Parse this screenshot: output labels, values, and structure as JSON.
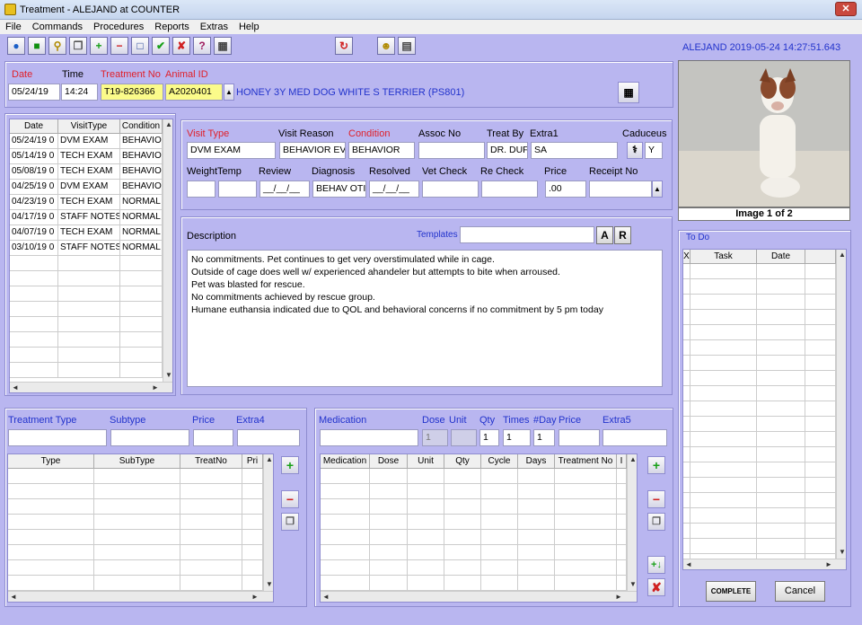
{
  "window": {
    "title": "Treatment  -  ALEJAND at COUNTER"
  },
  "menu": [
    "File",
    "Commands",
    "Procedures",
    "Reports",
    "Extras",
    "Help"
  ],
  "status": "ALEJAND 2019-05-24 14:27:51.643",
  "header": {
    "date_label": "Date",
    "time_label": "Time",
    "treatno_label": "Treatment No",
    "animal_label": "Animal ID",
    "date": "05/24/19",
    "time": "14:24",
    "treatno": "T19-826366",
    "animal": "A2020401",
    "animal_desc": "HONEY 3Y MED DOG WHITE S TERRIER (PS801)"
  },
  "photo": {
    "caption": "Image 1 of 2"
  },
  "history": {
    "columns": [
      "Date",
      "VisitType",
      "Condition"
    ],
    "rows": [
      [
        "05/24/19 0",
        "DVM EXAM",
        "BEHAVIOI"
      ],
      [
        "05/14/19 0",
        "TECH EXAM",
        "BEHAVIOI"
      ],
      [
        "05/08/19 0",
        "TECH EXAM",
        "BEHAVIOI"
      ],
      [
        "04/25/19 0",
        "DVM EXAM",
        "BEHAVIOI"
      ],
      [
        "04/23/19 0",
        "TECH EXAM",
        "NORMAL"
      ],
      [
        "04/17/19 0",
        "STAFF NOTES",
        "NORMAL"
      ],
      [
        "04/07/19 0",
        "TECH EXAM",
        "NORMAL"
      ],
      [
        "03/10/19 0",
        "STAFF NOTES",
        "NORMAL"
      ]
    ]
  },
  "visit": {
    "visit_type_label": "Visit Type",
    "visit_reason_label": "Visit Reason",
    "condition_label": "Condition",
    "assoc_label": "Assoc No",
    "treatby_label": "Treat By",
    "extra1_label": "Extra1",
    "caduceus_label": "Caduceus",
    "visit_type": "DVM EXAM",
    "visit_reason": "BEHAVIOR EV",
    "condition": "BEHAVIOR",
    "assoc": "",
    "treatby": "DR. DUF",
    "extra1": "SA",
    "caduceus": "Y",
    "weight_label": "Weight",
    "temp_label": "Temp",
    "review_label": "Review",
    "diagnosis_label": "Diagnosis",
    "resolved_label": "Resolved",
    "vetcheck_label": "Vet Check",
    "recheck_label": "Re Check",
    "price_label": "Price",
    "receipt_label": "Receipt No",
    "weight": "",
    "temp": "",
    "review": "__/__/__",
    "diagnosis": "BEHAV OTI",
    "resolved": "__/__/__",
    "vetcheck": "",
    "recheck": "",
    "price": ".00",
    "receipt": ""
  },
  "description": {
    "label": "Description",
    "templates_label": "Templates",
    "btn_a": "A",
    "btn_r": "R",
    "text": "No commitments. Pet continues to get very overstimulated while in cage.\nOutside of cage does well w/ experienced ahandeler but attempts to bite when arroused.\nPet was blasted for rescue.\nNo commitments achieved by rescue group.\nHumane euthansia indicated due to QOL and behavioral concerns if no commitment by 5 pm today"
  },
  "todo": {
    "label": "To Do",
    "columns": [
      "X",
      "Task",
      "Date"
    ]
  },
  "treatment": {
    "type_label": "Treatment Type",
    "subtype_label": "Subtype",
    "price_label": "Price",
    "extra4_label": "Extra4",
    "columns": [
      "Type",
      "SubType",
      "TreatNo",
      "Pri"
    ]
  },
  "medication": {
    "med_label": "Medication",
    "dose_label": "Dose",
    "unit_label": "Unit",
    "qty_label": "Qty",
    "times_label": "Times",
    "days_label": "#Day",
    "price_label": "Price",
    "extra5_label": "Extra5",
    "dose": "1",
    "qty": "1",
    "times": "1",
    "days": "1",
    "columns": [
      "Medication",
      "Dose",
      "Unit",
      "Qty",
      "Cycle",
      "Days",
      "Treatment No",
      "I"
    ]
  },
  "buttons": {
    "complete": "COMPLETE",
    "cancel": "Cancel"
  }
}
